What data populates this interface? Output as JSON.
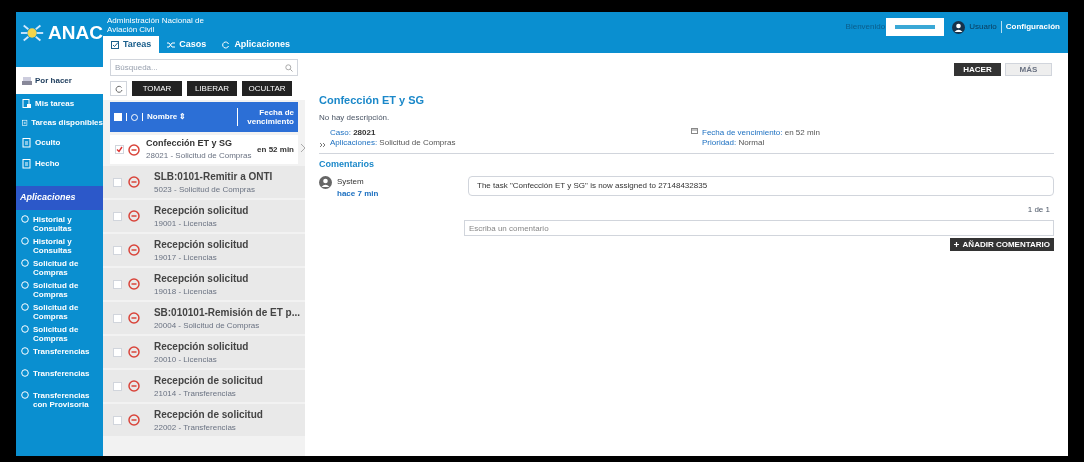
{
  "header": {
    "logo": "ANAC",
    "agency": "Administración Nacional de Aviación Civil",
    "welcome": "Bienvenido",
    "user": "Usuario",
    "settings": "Configuración"
  },
  "tabs": [
    {
      "label": "Tareas",
      "selected": true
    },
    {
      "label": "Casos",
      "selected": false
    },
    {
      "label": "Aplicaciones",
      "selected": false
    }
  ],
  "nav": [
    {
      "label": "Por hacer",
      "selected": true,
      "children": [
        {
          "label": "Mis tareas",
          "selected": false
        },
        {
          "label": "Tareas disponibles",
          "selected": false
        }
      ]
    },
    {
      "label": "Oculto",
      "selected": false
    },
    {
      "label": "Hecho",
      "selected": false
    }
  ],
  "applications": {
    "heading": "Aplicaciones",
    "items": [
      "Historial y Consultas",
      "Historial y Consultas",
      "Solicitud de Compras",
      "Solicitud de Compras",
      "Solicitud de Compras",
      "Solicitud de Compras",
      "Transferencias",
      "Transferencias",
      "Transferencias con Provisoria"
    ]
  },
  "task_list": {
    "select_all_checked": false,
    "search_placeholder": "Búsqueda...",
    "buttons": [
      "TOMAR",
      "LIBERAR",
      "OCULTAR"
    ],
    "columns": [
      "Nombre ⇕",
      "Fecha de vencimiento"
    ],
    "rows": [
      {
        "title": "Confección ET y SG",
        "subtitle": "28021 - Solicitud de Compras",
        "due": "en 52 min",
        "checked": true,
        "selected": true
      },
      {
        "title": "SLB:0101-Remitir a ONTI",
        "subtitle": "5023 - Solicitud de Compras",
        "checked": false,
        "selected": false
      },
      {
        "title": "Recepción solicitud",
        "subtitle": "19001 - Licencias",
        "checked": false,
        "selected": false
      },
      {
        "title": "Recepción solicitud",
        "subtitle": "19017 - Licencias",
        "checked": false,
        "selected": false
      },
      {
        "title": "Recepción solicitud",
        "subtitle": "19018 - Licencias",
        "checked": false,
        "selected": false
      },
      {
        "title": "SB:010101-Remisión de ET p...",
        "subtitle": "20004 - Solicitud de Compras",
        "checked": false,
        "selected": false
      },
      {
        "title": "Recepción solicitud",
        "subtitle": "20010 - Licencias",
        "checked": false,
        "selected": false
      },
      {
        "title": "Recepción de solicitud",
        "subtitle": "21014 - Transferencias",
        "checked": false,
        "selected": false
      },
      {
        "title": "Recepción de solicitud",
        "subtitle": "22002 - Transferencias",
        "checked": false,
        "selected": false
      }
    ]
  },
  "detail": {
    "actions": [
      {
        "label": "HACER",
        "kind": "primary"
      },
      {
        "label": "MÁS",
        "kind": "secondary"
      }
    ],
    "title": "Confección ET y SG",
    "description": "No hay descripción.",
    "case_label": "Caso:",
    "case_value": "28021",
    "app_label": "Aplicaciones:",
    "app_value": "Solicitud de Compras",
    "due_label": "Fecha de vencimiento:",
    "due_value": "en 52 min",
    "priority_label": "Prioridad:",
    "priority_value": "Normal",
    "comments_heading": "Comentarios",
    "comments": [
      {
        "author": "System",
        "time": "hace 7 min",
        "text": "The task \"Confección ET y SG\" is now assigned to 27148432835"
      }
    ],
    "pager": "1 de 1",
    "comment_placeholder": "Escriba un comentario",
    "add_button": "AÑADIR COMENTARIO"
  }
}
